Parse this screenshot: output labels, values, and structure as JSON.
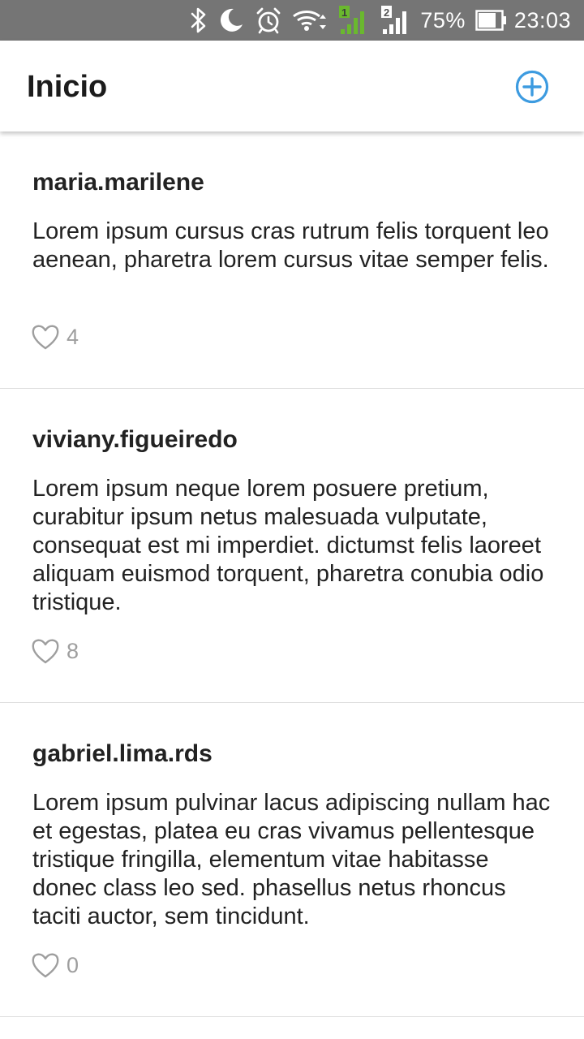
{
  "status_bar": {
    "battery_percent": "75%",
    "time": "23:03",
    "sim1_label": "1",
    "sim2_label": "2",
    "icons": [
      "bluetooth-icon",
      "moon-icon",
      "alarm-icon",
      "wifi-icon",
      "signal-sim1-icon",
      "signal-sim2-icon",
      "battery-icon"
    ]
  },
  "app_bar": {
    "title": "Inicio",
    "add_icon": "plus-circle-icon",
    "accent_color": "#3d9be0"
  },
  "posts": [
    {
      "username": "maria.marilene",
      "text": "Lorem ipsum cursus cras rutrum felis torquent leo aenean, pharetra lorem cursus vitae semper felis.",
      "likes": "4"
    },
    {
      "username": "viviany.figueiredo",
      "text": "Lorem ipsum neque lorem posuere pretium, curabitur ipsum netus malesuada vulputate, consequat est mi imperdiet. dictumst felis laoreet aliquam euismod torquent, pharetra conubia odio tristique.",
      "likes": "8"
    },
    {
      "username": "gabriel.lima.rds",
      "text": "Lorem ipsum pulvinar lacus adipiscing nullam hac et egestas, platea eu cras vivamus pellentesque tristique fringilla, elementum vitae habitasse donec class leo sed. phasellus netus rhoncus taciti auctor, sem tincidunt.",
      "likes": "0"
    }
  ]
}
